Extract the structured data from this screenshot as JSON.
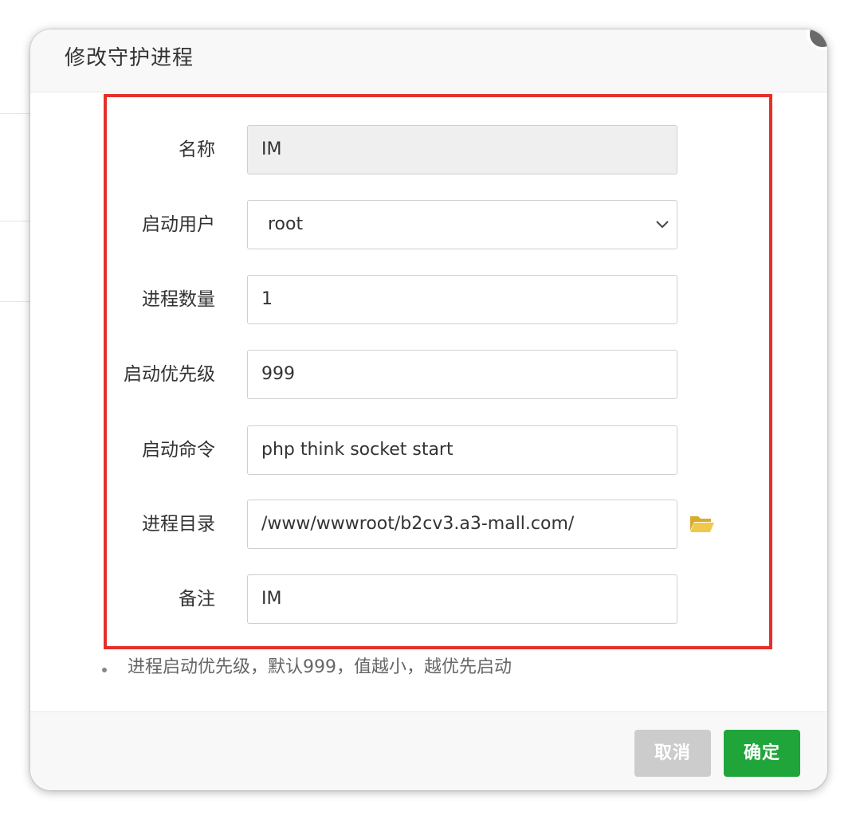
{
  "dialog": {
    "title": "修改守护进程"
  },
  "form": {
    "name": {
      "label": "名称",
      "value": "IM"
    },
    "user": {
      "label": "启动用户",
      "value": "root"
    },
    "process_count": {
      "label": "进程数量",
      "value": "1"
    },
    "priority": {
      "label": "启动优先级",
      "value": "999"
    },
    "command": {
      "label": "启动命令",
      "value": "php think socket start"
    },
    "directory": {
      "label": "进程目录",
      "value": "/www/wwwroot/b2cv3.a3-mall.com/"
    },
    "remark": {
      "label": "备注",
      "value": "IM"
    }
  },
  "hint": "进程启动优先级，默认999，值越小，越优先启动",
  "footer": {
    "cancel_label": "取消",
    "confirm_label": "确定"
  },
  "icons": {
    "folder": "folder-open-icon",
    "chevron": "chevron-down-icon",
    "close": "close-icon"
  },
  "colors": {
    "primary": "#20a53a",
    "highlight_border": "#e5302a",
    "folder": "#f0c94a",
    "cancel": "#cccccc"
  }
}
